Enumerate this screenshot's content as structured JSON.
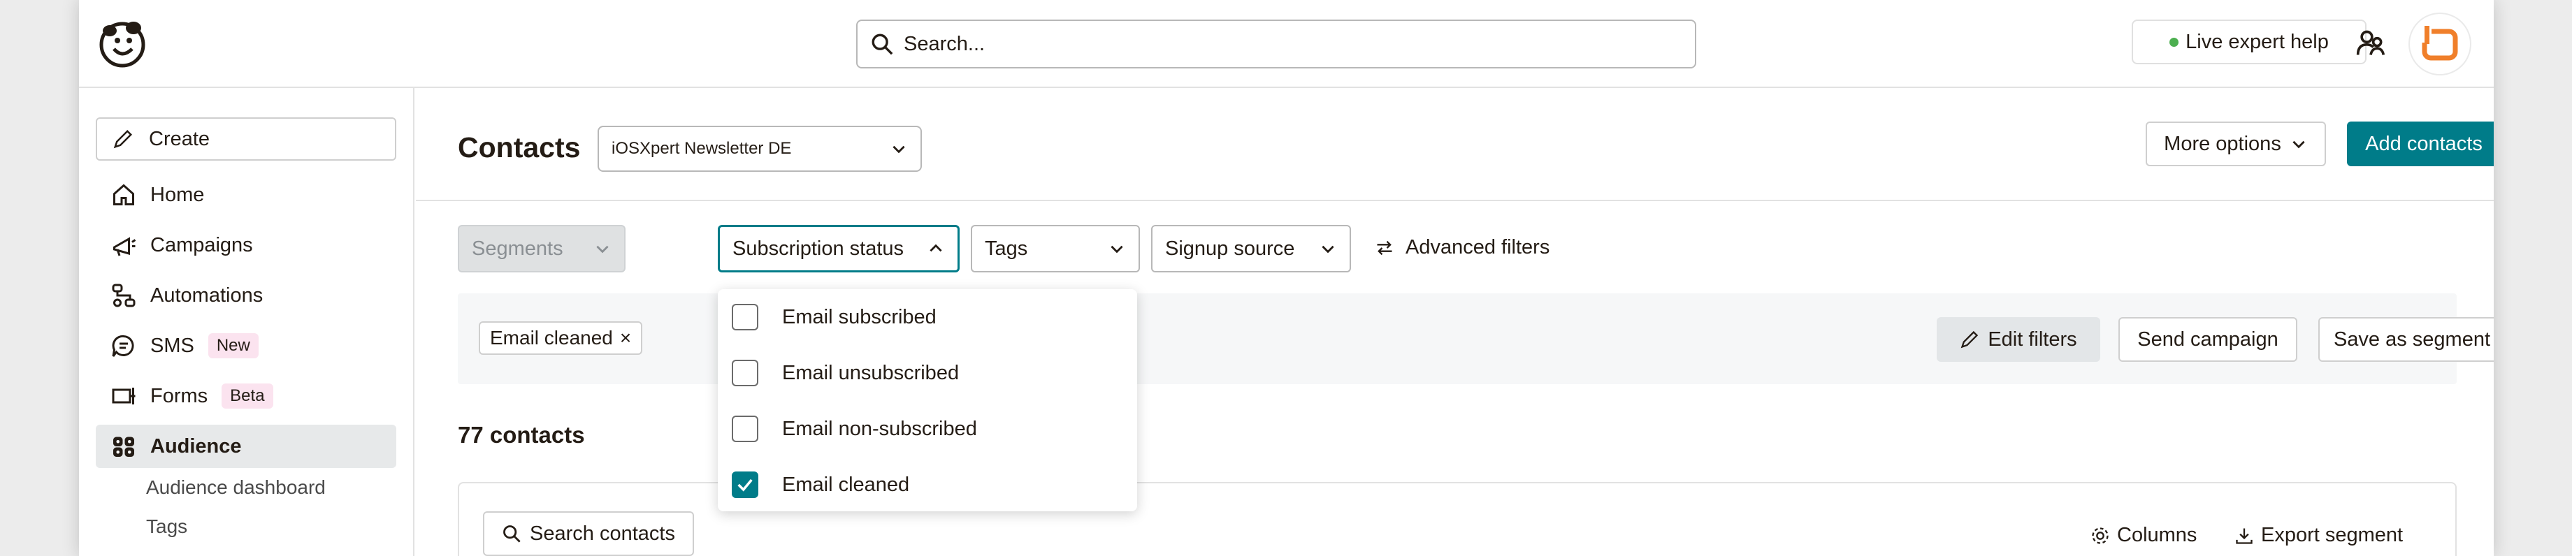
{
  "header": {
    "search_placeholder": "Search...",
    "live_help_label": "Live expert help"
  },
  "sidebar": {
    "create_label": "Create",
    "items": [
      {
        "label": "Home",
        "icon": "home-icon"
      },
      {
        "label": "Campaigns",
        "icon": "megaphone-icon"
      },
      {
        "label": "Automations",
        "icon": "automations-icon"
      },
      {
        "label": "SMS",
        "icon": "sms-icon",
        "badge": "New"
      },
      {
        "label": "Forms",
        "icon": "forms-icon",
        "badge": "Beta"
      },
      {
        "label": "Audience",
        "icon": "audience-icon",
        "active": true
      }
    ],
    "sub_items": [
      "Audience dashboard",
      "Tags"
    ]
  },
  "main": {
    "title": "Contacts",
    "audience_select": "iOSXpert Newsletter DE",
    "more_options_label": "More options",
    "add_contacts_label": "Add contacts",
    "filters": {
      "segments": "Segments",
      "subscription_status": "Subscription status",
      "tags": "Tags",
      "signup_source": "Signup source",
      "advanced": "Advanced filters"
    },
    "active_chip": "Email cleaned",
    "edit_filters_label": "Edit filters",
    "send_campaign_label": "Send campaign",
    "save_segment_label": "Save as segment",
    "count_label": "77 contacts",
    "search_contacts_label": "Search contacts",
    "columns_label": "Columns",
    "export_label": "Export segment"
  },
  "dropdown": {
    "options": [
      {
        "label": "Email subscribed",
        "checked": false
      },
      {
        "label": "Email unsubscribed",
        "checked": false
      },
      {
        "label": "Email non-subscribed",
        "checked": false
      },
      {
        "label": "Email cleaned",
        "checked": true
      }
    ]
  },
  "colors": {
    "accent": "#007c89",
    "badge_bg": "#fbe3ef",
    "live_dot": "#4caf50"
  }
}
